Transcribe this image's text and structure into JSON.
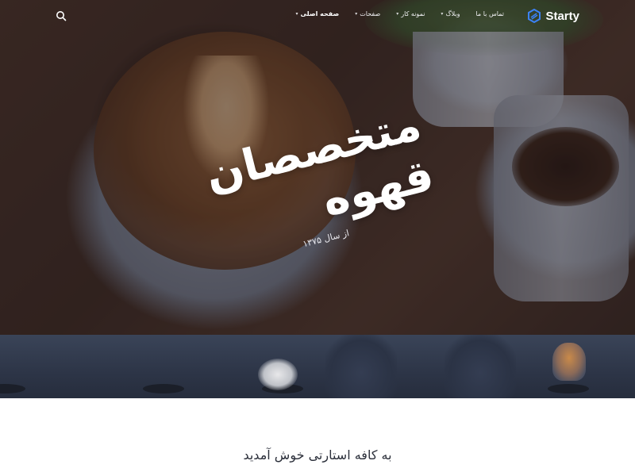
{
  "brand": {
    "name": "Starty",
    "accent": "#3b82f6"
  },
  "nav": {
    "items": [
      {
        "label": "صفحه اصلی",
        "active": true,
        "has_dropdown": true
      },
      {
        "label": "صفحات",
        "active": false,
        "has_dropdown": true
      },
      {
        "label": "نمونه کار",
        "active": false,
        "has_dropdown": true
      },
      {
        "label": "وبلاگ",
        "active": false,
        "has_dropdown": true
      },
      {
        "label": "تماس با ما",
        "active": false,
        "has_dropdown": false
      }
    ],
    "search_icon": "search-icon",
    "dropdown_icon": "chevron-down-icon"
  },
  "hero": {
    "title_line1": "متخصصان",
    "title_line2": "قهوه",
    "subtitle": "از سال ۱۳۷۵"
  },
  "welcome": {
    "title": "به کافه استارتی خوش آمدید"
  }
}
